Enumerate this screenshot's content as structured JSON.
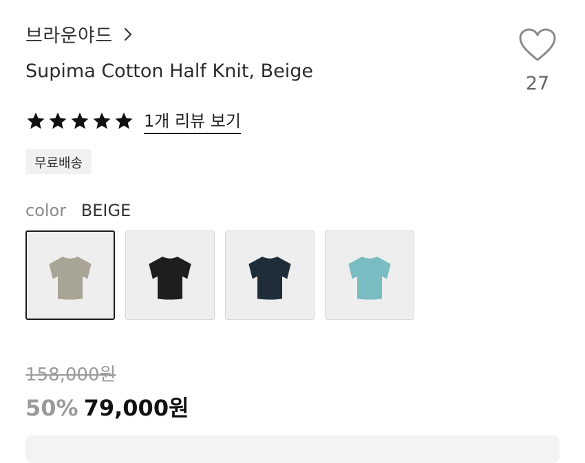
{
  "brand": {
    "name": "브라운야드"
  },
  "product": {
    "title": "Supima Cotton Half Knit, Beige"
  },
  "like": {
    "count": "27"
  },
  "rating": {
    "stars": 5,
    "review_link": "1개 리뷰 보기"
  },
  "badge": {
    "label": "무료배송"
  },
  "color": {
    "label": "color",
    "selected": "BEIGE",
    "options": [
      {
        "color": "#a9a596"
      },
      {
        "color": "#1e1e1e"
      },
      {
        "color": "#1e2d38"
      },
      {
        "color": "#79bcc1"
      }
    ]
  },
  "price": {
    "original": "158,000원",
    "discount": "50%",
    "final": "79,000원"
  },
  "icons": {
    "brand_arrow": "chevron-right-icon",
    "like": "heart-icon",
    "star": "star-icon"
  }
}
